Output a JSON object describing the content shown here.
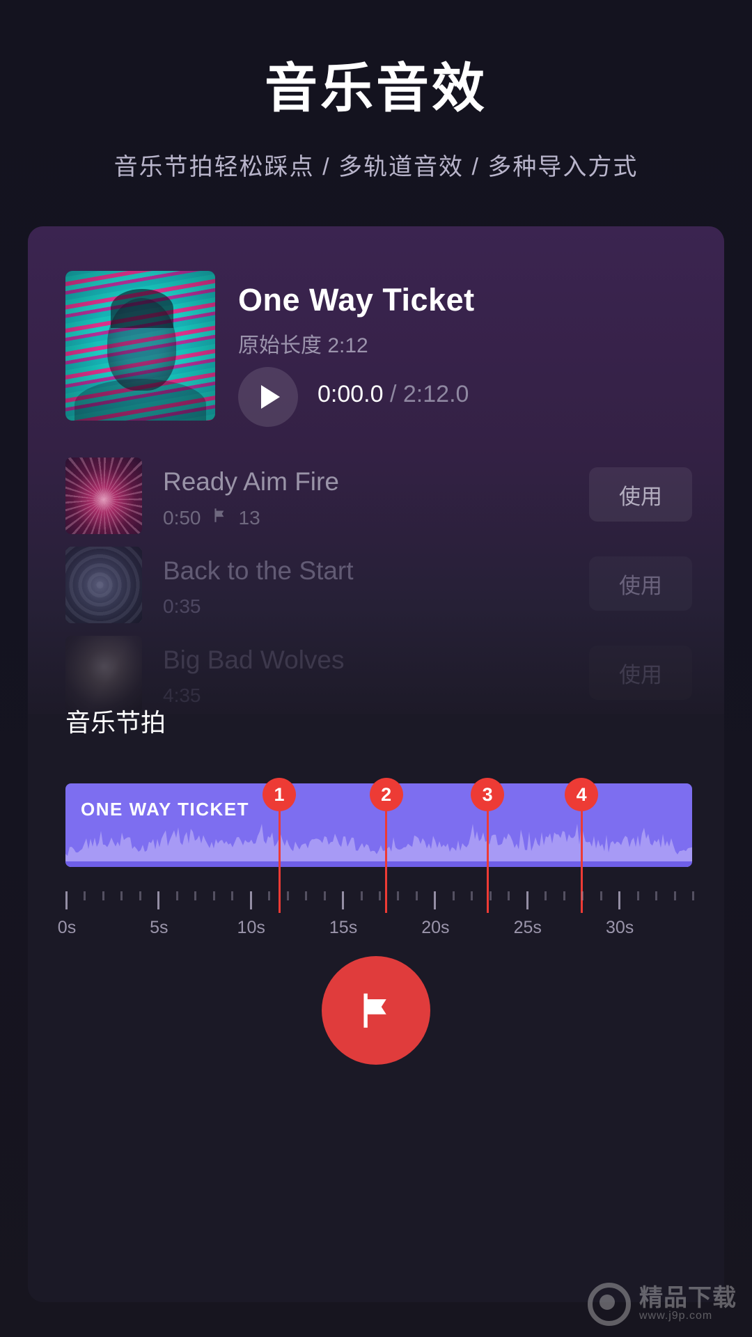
{
  "header": {
    "title": "音乐音效",
    "subtitle": "音乐节拍轻松踩点 / 多轨道音效 / 多种导入方式"
  },
  "now_playing": {
    "title": "One Way Ticket",
    "original_length_label": "原始长度 2:12",
    "current_time": "0:00.0",
    "separator": "/",
    "total_time": "2:12.0",
    "play_icon": "play-icon",
    "album_art": "album-art-one-way-ticket"
  },
  "tracks": [
    {
      "title": "Ready Aim Fire",
      "duration": "0:50",
      "flag_icon": "flag-icon",
      "beat_count": "13",
      "use_label": "使用",
      "thumb": "thumb-ready-aim-fire"
    },
    {
      "title": "Back to the Start",
      "duration": "0:35",
      "flag_icon": "",
      "beat_count": "",
      "use_label": "使用",
      "thumb": "thumb-back-to-the-start"
    },
    {
      "title": "Big Bad Wolves",
      "duration": "4:35",
      "flag_icon": "",
      "beat_count": "",
      "use_label": "使用",
      "thumb": "thumb-big-bad-wolves"
    }
  ],
  "beats": {
    "section_label": "音乐节拍",
    "waveform_name": "ONE WAY TICKET",
    "markers": [
      {
        "label": "1",
        "time_s": 11.6
      },
      {
        "label": "2",
        "time_s": 17.4
      },
      {
        "label": "3",
        "time_s": 22.9
      },
      {
        "label": "4",
        "time_s": 28.0
      }
    ],
    "ruler": {
      "major_labels": [
        "0s",
        "5s",
        "10s",
        "15s",
        "20s",
        "25s",
        "30s"
      ],
      "major_values": [
        0,
        5,
        10,
        15,
        20,
        25,
        30
      ],
      "minor_step_s": 1,
      "range_s": [
        0,
        34
      ]
    },
    "add_beat_button_icon": "flag-icon"
  },
  "colors": {
    "page_bg": "#14131f",
    "card_bg": "#1b1926",
    "accent_red": "#ed3b35",
    "fab_red": "#e03c3c",
    "wave_purple": "#7d6ef0",
    "wave_fill": "#a79af5",
    "text_primary": "#ffffff",
    "text_muted": "#9c94ad"
  },
  "watermark": {
    "logo_icon": "p-logo-icon",
    "name": "精品下载",
    "url": "www.j9p.com"
  }
}
